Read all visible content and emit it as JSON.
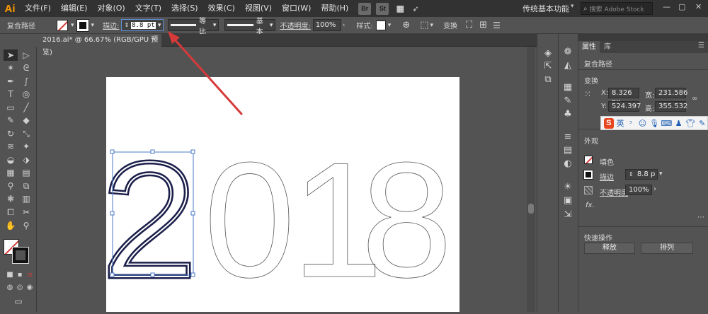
{
  "menubar": {
    "logo": "Ai",
    "items": [
      "文件(F)",
      "编辑(E)",
      "对象(O)",
      "文字(T)",
      "选择(S)",
      "效果(C)",
      "视图(V)",
      "窗口(W)",
      "帮助(H)"
    ],
    "bridge": "Br",
    "stock": "St",
    "workspace": "传统基本功能",
    "search_placeholder": "搜索 Adobe Stock"
  },
  "control_bar": {
    "selection_type": "复合路径",
    "stroke_label": "描边:",
    "stroke_value": "8.8 pt",
    "profile_label": "等比",
    "brush_label": "基本",
    "opacity_label": "不透明度:",
    "opacity_value": "100%",
    "style_label": "样式:",
    "transform_label": "变换"
  },
  "document": {
    "tab_title": "2016.ai* @ 66.67% (RGB/GPU 预览)",
    "artwork_text": [
      "2",
      "0",
      "1",
      "8"
    ]
  },
  "properties_panel": {
    "tabs": [
      "属性",
      "库"
    ],
    "selection_label": "复合路径",
    "transform_title": "变换",
    "x_label": "X:",
    "x_value": "8.326 px",
    "w_label": "宽:",
    "w_value": "231.586",
    "y_label": "Y:",
    "y_value": "524.397",
    "h_label": "高:",
    "h_value": "355.532",
    "appearance_title": "外观",
    "fill_label": "填色",
    "stroke_label": "描边",
    "stroke_value": "8.8 p",
    "opacity_label": "不透明度",
    "opacity_value": "100%",
    "fx_label": "fx.",
    "quick_actions_title": "快速操作",
    "release_button": "释放",
    "arrange_button": "排列"
  },
  "ime_bar": {
    "logo": "S",
    "lang": "英"
  },
  "colors": {
    "accent_red": "#d63a3a",
    "path_stroke": "#1b1f4a",
    "selection_blue": "#4a78c8",
    "logo_orange": "#ff9a00"
  }
}
